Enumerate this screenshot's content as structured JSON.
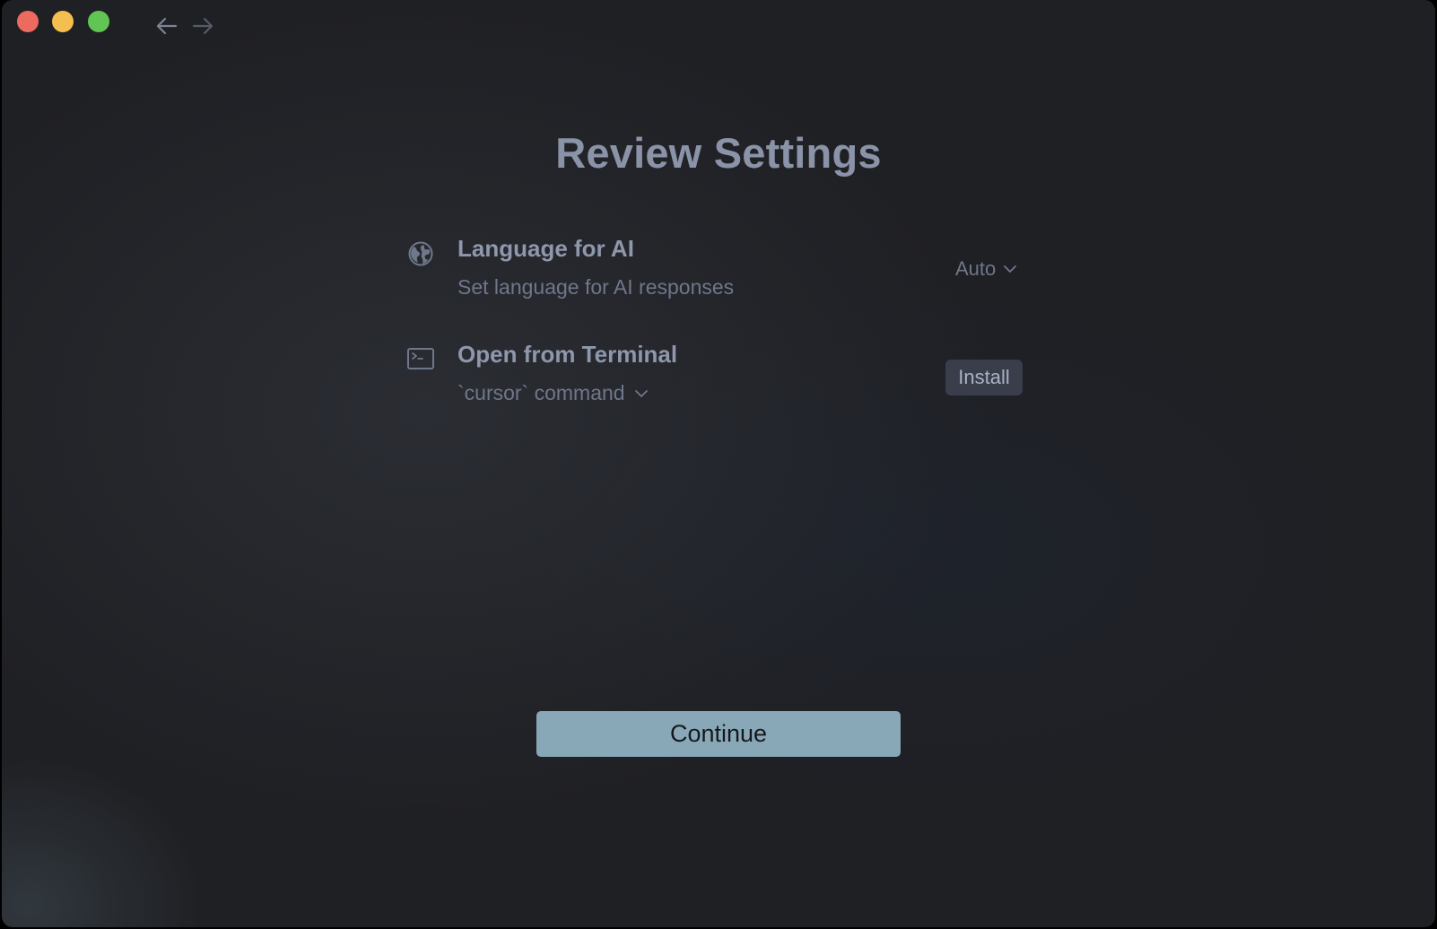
{
  "window": {
    "controls": [
      "close",
      "minimize",
      "zoom"
    ],
    "nav": {
      "back_icon": "arrow-left-icon",
      "forward_icon": "arrow-right-icon"
    }
  },
  "page": {
    "title": "Review Settings"
  },
  "settings": {
    "language": {
      "icon": "globe-icon",
      "title": "Language for AI",
      "description": "Set language for AI responses",
      "selected_value": "Auto"
    },
    "terminal": {
      "icon": "terminal-icon",
      "title": "Open from Terminal",
      "description": "`cursor` command",
      "action_label": "Install"
    }
  },
  "footer": {
    "continue_label": "Continue"
  },
  "colors": {
    "background": "#1f2024",
    "title_text": "#8a93a8",
    "muted_text": "#6f778a",
    "install_button_bg": "#3a3e4a",
    "continue_button_bg": "#88a8b8",
    "close": "#ed6a5e",
    "minimize": "#f5bf4f",
    "zoom": "#61c554"
  }
}
